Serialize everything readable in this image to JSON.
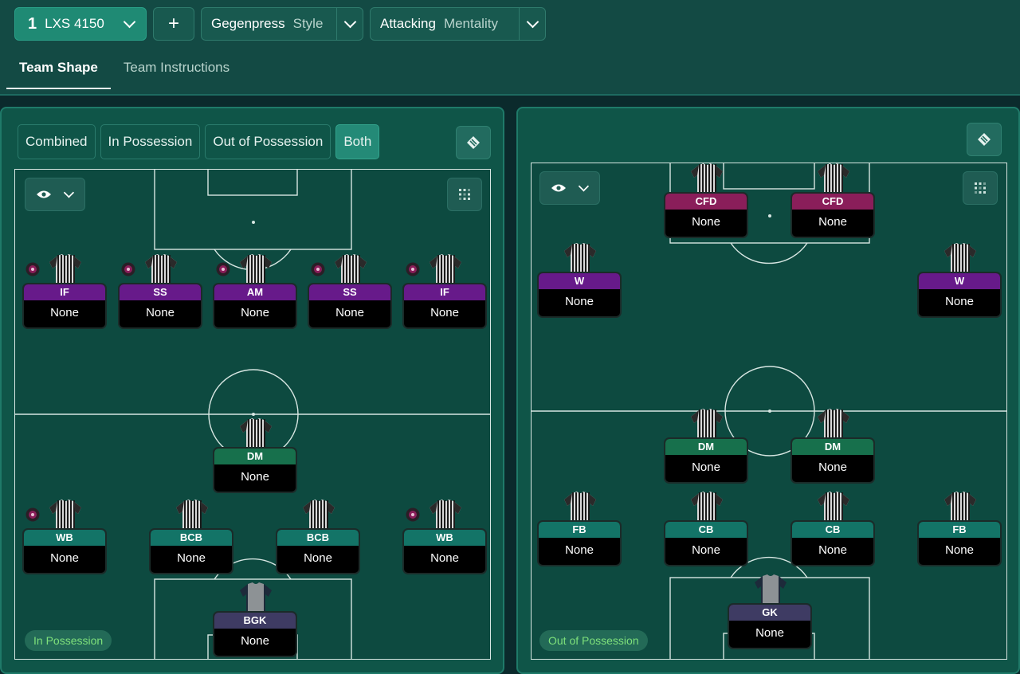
{
  "header": {
    "tactic": {
      "number": "1",
      "name": "LXS 4150"
    },
    "add_label": "+",
    "style": {
      "value": "Gegenpress",
      "label": "Style"
    },
    "mentality": {
      "value": "Attacking",
      "label": "Mentality"
    },
    "tabs": [
      {
        "label": "Team Shape",
        "active": true
      },
      {
        "label": "Team Instructions",
        "active": false
      }
    ]
  },
  "left_panel": {
    "segments": [
      {
        "label": "Combined",
        "active": false
      },
      {
        "label": "In Possession",
        "active": false
      },
      {
        "label": "Out of Possession",
        "active": false
      },
      {
        "label": "Both",
        "active": true
      }
    ],
    "phase_label": "In Possession",
    "players": [
      {
        "role": "IF",
        "duty": "None",
        "color": "#671a8a",
        "ball": true
      },
      {
        "role": "SS",
        "duty": "None",
        "color": "#671a8a",
        "ball": true
      },
      {
        "role": "AM",
        "duty": "None",
        "color": "#671a8a",
        "ball": true
      },
      {
        "role": "SS",
        "duty": "None",
        "color": "#671a8a",
        "ball": true
      },
      {
        "role": "IF",
        "duty": "None",
        "color": "#671a8a",
        "ball": true
      },
      {
        "role": "DM",
        "duty": "None",
        "color": "#17704c",
        "ball": false
      },
      {
        "role": "WB",
        "duty": "None",
        "color": "#137467",
        "ball": true
      },
      {
        "role": "BCB",
        "duty": "None",
        "color": "#137467",
        "ball": false
      },
      {
        "role": "BCB",
        "duty": "None",
        "color": "#137467",
        "ball": false
      },
      {
        "role": "WB",
        "duty": "None",
        "color": "#137467",
        "ball": true
      },
      {
        "role": "BGK",
        "duty": "None",
        "color": "#3e3b63",
        "ball": false,
        "gk": true
      }
    ]
  },
  "right_panel": {
    "phase_label": "Out of Possession",
    "players": [
      {
        "role": "CFD",
        "duty": "None",
        "color": "#8a1e5a"
      },
      {
        "role": "CFD",
        "duty": "None",
        "color": "#8a1e5a"
      },
      {
        "role": "W",
        "duty": "None",
        "color": "#671a8a"
      },
      {
        "role": "W",
        "duty": "None",
        "color": "#671a8a"
      },
      {
        "role": "DM",
        "duty": "None",
        "color": "#17704c"
      },
      {
        "role": "DM",
        "duty": "None",
        "color": "#17704c"
      },
      {
        "role": "FB",
        "duty": "None",
        "color": "#137467"
      },
      {
        "role": "CB",
        "duty": "None",
        "color": "#137467"
      },
      {
        "role": "CB",
        "duty": "None",
        "color": "#137467"
      },
      {
        "role": "FB",
        "duty": "None",
        "color": "#137467"
      },
      {
        "role": "GK",
        "duty": "None",
        "color": "#3e3b63",
        "gk": true
      }
    ]
  },
  "icons": {
    "tactic_chevron": "chevron-down-icon",
    "eye": "eye-icon",
    "grid": "grid-icon",
    "tactics_board": "tactics-board-icon"
  }
}
